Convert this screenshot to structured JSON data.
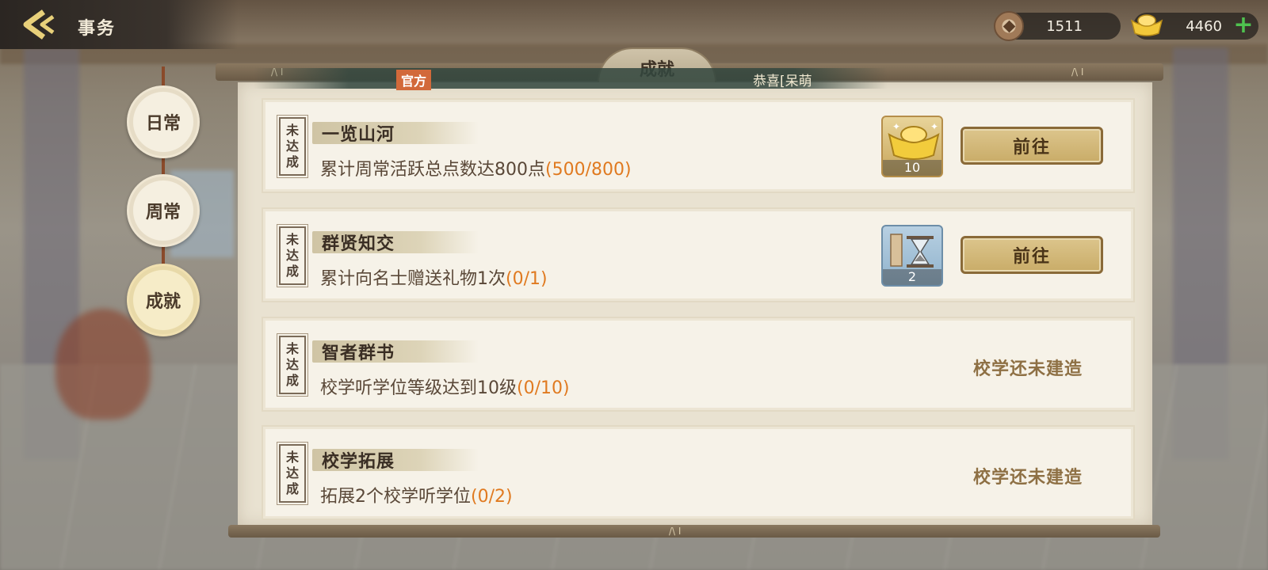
{
  "header": {
    "back_icon": "chevron-left-icon",
    "title": "事务"
  },
  "currency": {
    "copper": {
      "icon": "copper-coin-icon",
      "value": "1511"
    },
    "gold": {
      "icon": "gold-ingot-icon",
      "value": "4460"
    },
    "plus_label": "+"
  },
  "tabs": [
    {
      "label": "日常",
      "active": false
    },
    {
      "label": "周常",
      "active": false
    },
    {
      "label": "成就",
      "active": true
    }
  ],
  "panel": {
    "title": "成就",
    "broadcast_tag": "官方",
    "broadcast_text": "恭喜[呆萌"
  },
  "achievements": [
    {
      "stamp": [
        "未",
        "达",
        "成"
      ],
      "title": "一览山河",
      "desc": "累计周常活跃总点数达800点",
      "progress": "(500/800)",
      "reward": {
        "icon": "gold-ingot-icon",
        "count": "10"
      },
      "action": "前往"
    },
    {
      "stamp": [
        "未",
        "达",
        "成"
      ],
      "title": "群贤知交",
      "desc": "累计向名士赠送礼物1次",
      "progress": "(0/1)",
      "reward": {
        "icon": "hourglass-icon",
        "count": "2"
      },
      "action": "前往"
    },
    {
      "stamp": [
        "未",
        "达",
        "成"
      ],
      "title": "智者群书",
      "desc": "校学听学位等级达到10级",
      "progress": "(0/10)",
      "status": "校学还未建造"
    },
    {
      "stamp": [
        "未",
        "达",
        "成"
      ],
      "title": "校学拓展",
      "desc": "拓展2个校学听学位",
      "progress": "(0/2)",
      "status": "校学还未建造"
    }
  ],
  "colors": {
    "progress": "#e07a20",
    "accent_gold": "#c9ac68",
    "panel_bg": "#e9e2d1"
  }
}
